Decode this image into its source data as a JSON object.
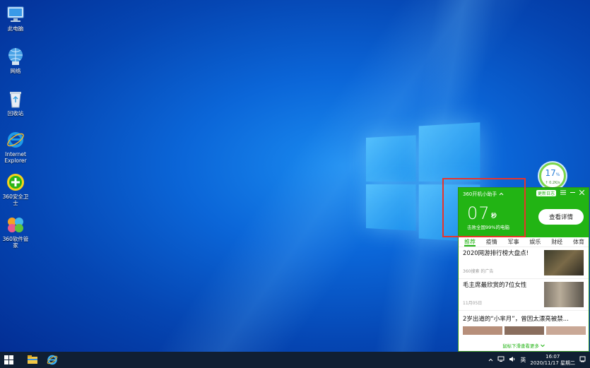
{
  "desktop": {
    "icons": [
      {
        "label": "此电脑",
        "icon": "computer-icon"
      },
      {
        "label": "网络",
        "icon": "network-icon"
      },
      {
        "label": "回收站",
        "icon": "recycle-bin-icon"
      },
      {
        "label": "Internet Explorer",
        "icon": "ie-icon"
      },
      {
        "label": "360安全卫士",
        "icon": "360-safe-icon"
      },
      {
        "label": "360软件管家",
        "icon": "360-software-icon"
      }
    ]
  },
  "gauge": {
    "percent": "17",
    "percent_sign": "%",
    "speed": "↑ 0.2K/s"
  },
  "popup": {
    "title": "360开机小助手",
    "badge": "更新日志",
    "boot_time": "07",
    "boot_unit": "秒",
    "beat_text": "击败全国99%的电脑",
    "details_button": "查看详情",
    "tabs": [
      "推荐",
      "疫情",
      "军事",
      "娱乐",
      "财经",
      "体育"
    ],
    "news": [
      {
        "title": "2020网游排行榜大盘点!",
        "meta": "360搜索 的广告"
      },
      {
        "title": "毛主席最欣赏的7位女性",
        "meta": "11月05日"
      },
      {
        "title": "2岁出道的“小芈月”，曾因太漂亮被禁...",
        "meta": ""
      }
    ],
    "more": "鼠标下滑查看更多"
  },
  "taskbar": {
    "ime": "英",
    "time": "16:07",
    "date": "2020/11/17 星期二"
  }
}
